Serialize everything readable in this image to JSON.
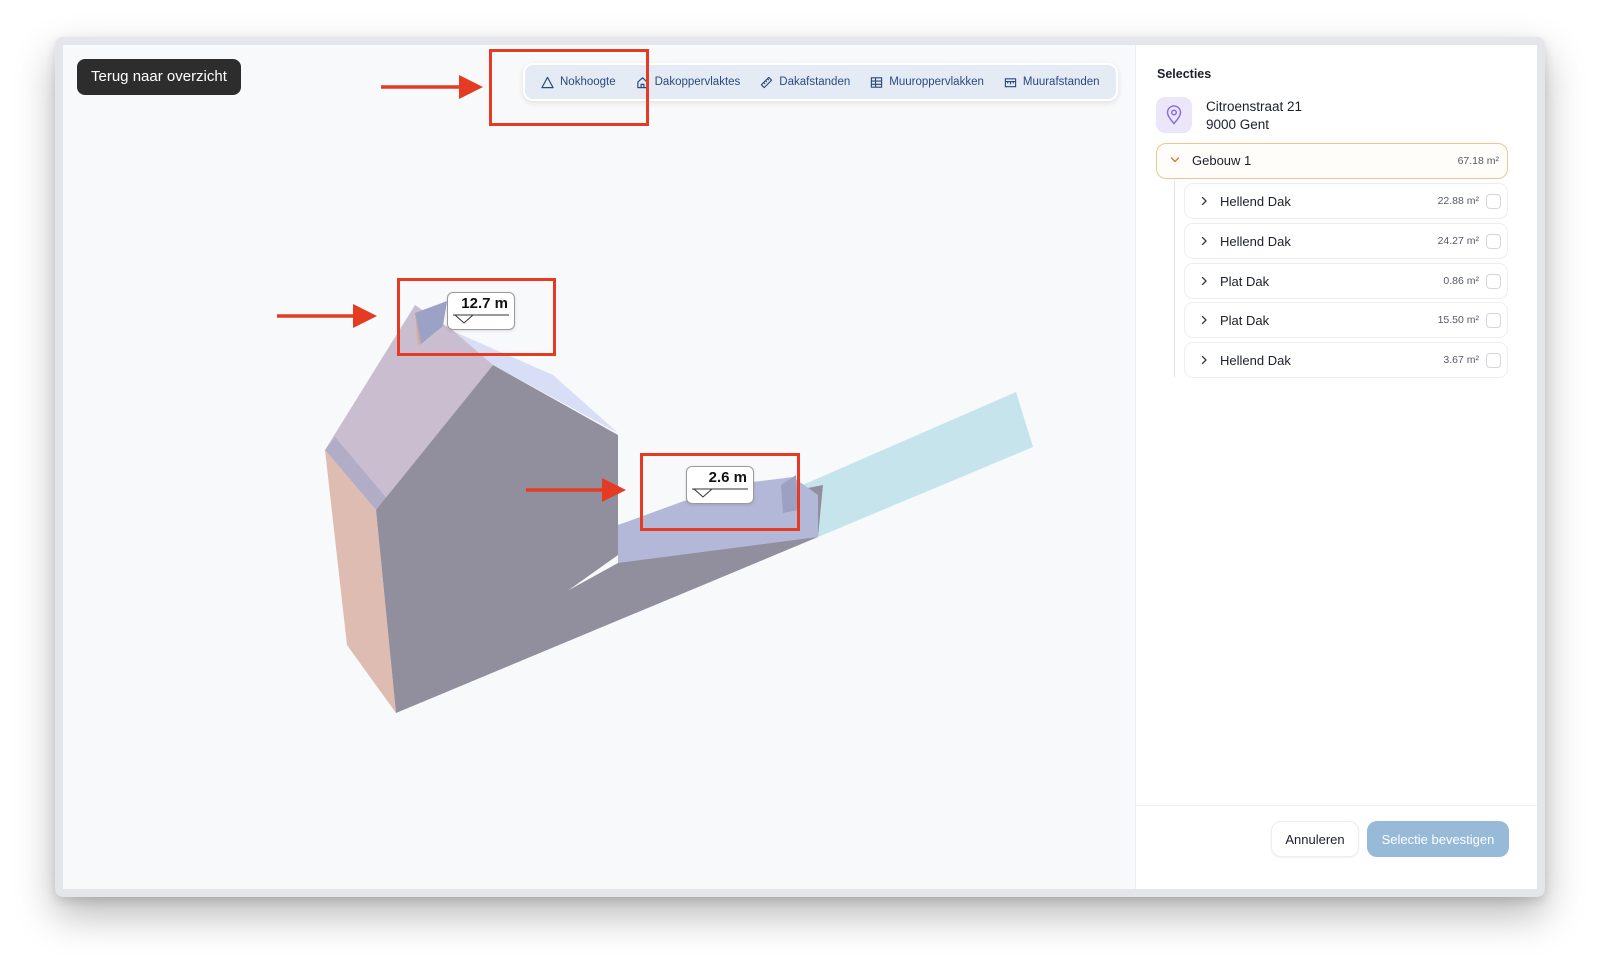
{
  "viewer": {
    "back_button_label": "Terug naar overzicht",
    "toolbar": {
      "items": [
        {
          "label": "Nokhoogte",
          "icon": "triangle-icon"
        },
        {
          "label": "Dakoppervlaktes",
          "icon": "house-icon"
        },
        {
          "label": "Dakafstanden",
          "icon": "ruler-icon"
        },
        {
          "label": "Muuroppervlakken",
          "icon": "wall-grid-icon"
        },
        {
          "label": "Muurafstanden",
          "icon": "wall-distance-icon"
        }
      ]
    },
    "measurements": [
      {
        "value": "12.7 m",
        "icon": "elevation-marker-icon"
      },
      {
        "value": "2.6 m",
        "icon": "elevation-marker-icon"
      }
    ],
    "annotation_color": "#e53b23",
    "colors": {
      "roof_left": "#cabdd0",
      "facade_front": "#918f9e",
      "facade_side": "#dfbcb1",
      "roof_right": "#d7def6",
      "annex_roof": "#b3b8d9",
      "annex_flat": "#c5e4ec"
    }
  },
  "sidebar": {
    "title": "Selecties",
    "address": {
      "line1": "Citroenstraat 21",
      "line2": "9000 Gent",
      "icon": "location-pin-icon"
    },
    "building": {
      "label": "Gebouw 1",
      "area": "67.18 m²",
      "expanded": true
    },
    "roofs": [
      {
        "label": "Hellend Dak",
        "area": "22.88 m²",
        "checked": false
      },
      {
        "label": "Hellend Dak",
        "area": "24.27 m²",
        "checked": false
      },
      {
        "label": "Plat Dak",
        "area": "0.86 m²",
        "checked": false
      },
      {
        "label": "Plat Dak",
        "area": "15.50 m²",
        "checked": false
      },
      {
        "label": "Hellend Dak",
        "area": "3.67 m²",
        "checked": false
      }
    ],
    "cancel_label": "Annuleren",
    "confirm_label": "Selectie bevestigen",
    "accent_color": "#f5a04b",
    "confirm_color": "#98bad9"
  }
}
